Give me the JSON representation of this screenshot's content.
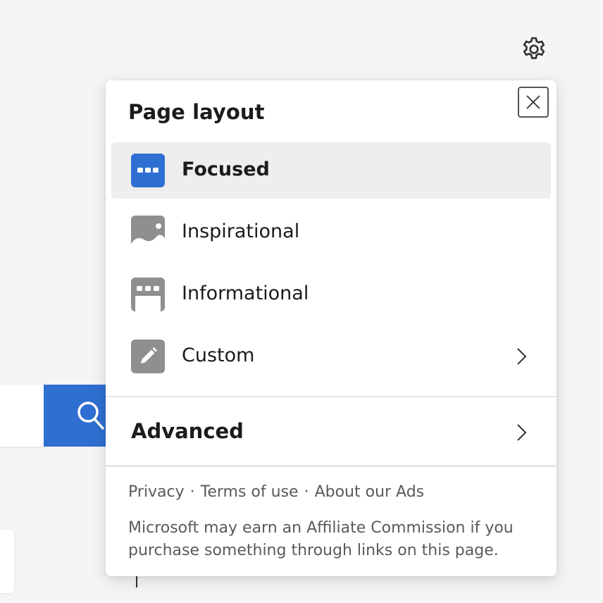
{
  "page": {
    "accent_color": "#2f6fd2",
    "background_color": "#f5f5f5"
  },
  "header": {
    "settings_icon": "gear-icon"
  },
  "search": {
    "button_icon": "search-icon"
  },
  "flyout": {
    "title": "Page layout",
    "close_icon": "close-icon",
    "layouts": [
      {
        "label": "Focused",
        "icon": "focused-layout-icon",
        "selected": true,
        "has_submenu": false
      },
      {
        "label": "Inspirational",
        "icon": "image-layout-icon",
        "selected": false,
        "has_submenu": false
      },
      {
        "label": "Informational",
        "icon": "informational-layout-icon",
        "selected": false,
        "has_submenu": false
      },
      {
        "label": "Custom",
        "icon": "pencil-icon",
        "selected": false,
        "has_submenu": true
      }
    ],
    "advanced": {
      "label": "Advanced",
      "icon": "chevron-right-icon"
    },
    "footer": {
      "links": [
        "Privacy",
        "Terms of use",
        "About our Ads"
      ],
      "separator": "·",
      "disclaimer": "Microsoft may earn an Affiliate Commission if you purchase something through links on this page."
    }
  }
}
